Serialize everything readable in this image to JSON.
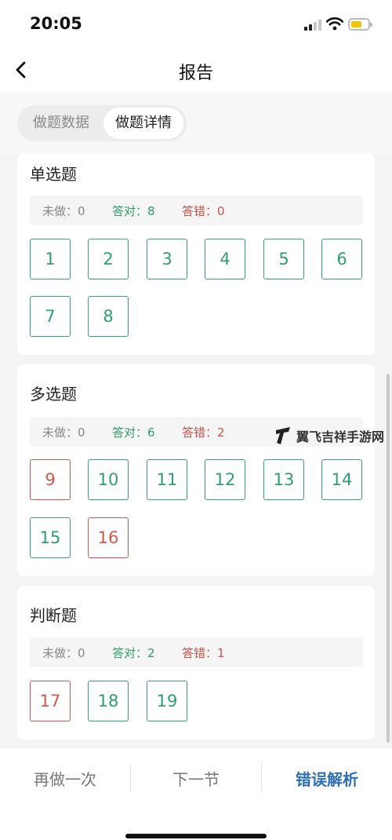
{
  "status_bar": {
    "time": "20:05"
  },
  "header": {
    "title": "报告"
  },
  "tabs": [
    {
      "label": "做题数据",
      "active": false
    },
    {
      "label": "做题详情",
      "active": true
    }
  ],
  "sections": [
    {
      "title": "单选题",
      "stats": {
        "undone_label": "未做：0",
        "correct_label": "答对：8",
        "wrong_label": "答错：0"
      },
      "questions": [
        {
          "number": "1",
          "status": "correct"
        },
        {
          "number": "2",
          "status": "correct"
        },
        {
          "number": "3",
          "status": "correct"
        },
        {
          "number": "4",
          "status": "correct"
        },
        {
          "number": "5",
          "status": "correct"
        },
        {
          "number": "6",
          "status": "correct"
        },
        {
          "number": "7",
          "status": "correct"
        },
        {
          "number": "8",
          "status": "correct"
        }
      ]
    },
    {
      "title": "多选题",
      "stats": {
        "undone_label": "未做：0",
        "correct_label": "答对：6",
        "wrong_label": "答错：2"
      },
      "questions": [
        {
          "number": "9",
          "status": "wrong"
        },
        {
          "number": "10",
          "status": "correct"
        },
        {
          "number": "11",
          "status": "correct"
        },
        {
          "number": "12",
          "status": "correct"
        },
        {
          "number": "13",
          "status": "correct"
        },
        {
          "number": "14",
          "status": "correct"
        },
        {
          "number": "15",
          "status": "correct"
        },
        {
          "number": "16",
          "status": "wrong"
        }
      ]
    },
    {
      "title": "判断题",
      "stats": {
        "undone_label": "未做：0",
        "correct_label": "答对：2",
        "wrong_label": "答错：1"
      },
      "questions": [
        {
          "number": "17",
          "status": "wrong"
        },
        {
          "number": "18",
          "status": "correct"
        },
        {
          "number": "19",
          "status": "correct"
        }
      ]
    }
  ],
  "watermark": {
    "text": "翼飞吉祥手游网"
  },
  "bottom_bar": {
    "redo_label": "再做一次",
    "next_label": "下一节",
    "analysis_label": "错误解析"
  },
  "colors": {
    "correct": "#2f9e6e",
    "wrong": "#cf5a4e",
    "accent": "#2f6fb8"
  }
}
